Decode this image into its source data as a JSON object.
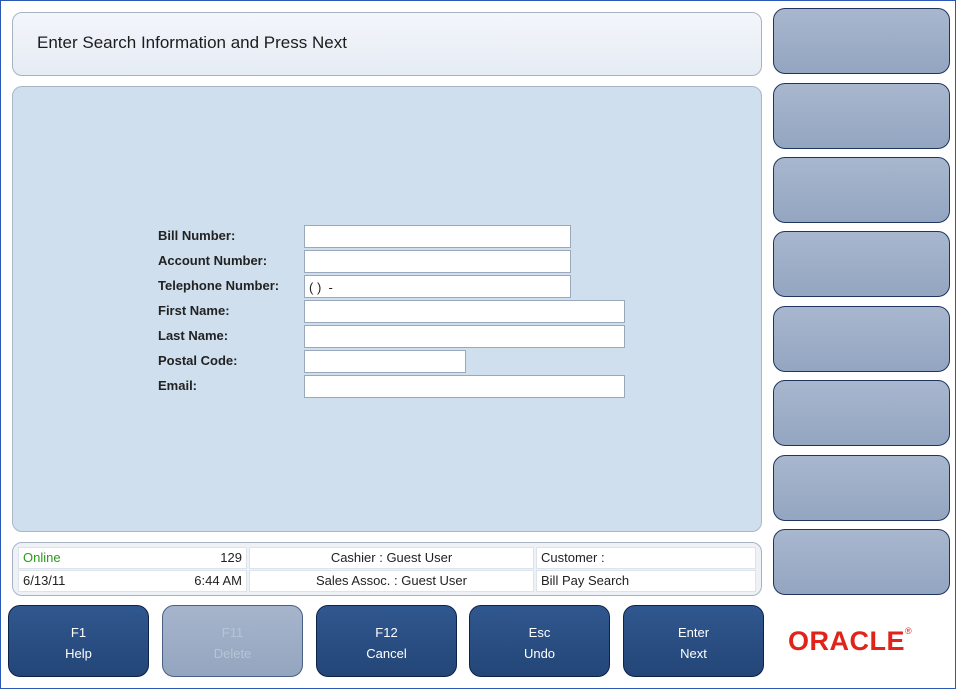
{
  "prompt": {
    "text": "Enter Search Information and Press Next"
  },
  "form": {
    "fields": [
      {
        "label": "Bill Number:",
        "value": ""
      },
      {
        "label": "Account Number:",
        "value": ""
      },
      {
        "label": "Telephone Number:",
        "value": "( )  -"
      },
      {
        "label": "First Name:",
        "value": ""
      },
      {
        "label": "Last Name:",
        "value": ""
      },
      {
        "label": "Postal Code:",
        "value": ""
      },
      {
        "label": "Email:",
        "value": ""
      }
    ]
  },
  "status": {
    "online": "Online",
    "register": "129",
    "cashier": "Cashier : Guest User",
    "customer": "Customer :",
    "date": "6/13/11",
    "time": "6:44 AM",
    "sales_assoc": "Sales Assoc. : Guest User",
    "screen": "Bill Pay Search",
    "online_color": "#2a9a1a"
  },
  "function_keys": [
    {
      "key": "F1",
      "action": "Help",
      "enabled": true
    },
    {
      "key": "F11",
      "action": "Delete",
      "enabled": false
    },
    {
      "key": "F12",
      "action": "Cancel",
      "enabled": true
    },
    {
      "key": "Esc",
      "action": "Undo",
      "enabled": true
    },
    {
      "key": "Enter",
      "action": "Next",
      "enabled": true
    }
  ],
  "side_buttons": [
    "",
    "",
    "",
    "",
    "",
    "",
    "",
    ""
  ],
  "brand": {
    "name": "ORACLE",
    "mark": "®",
    "color": "#e2231a"
  }
}
